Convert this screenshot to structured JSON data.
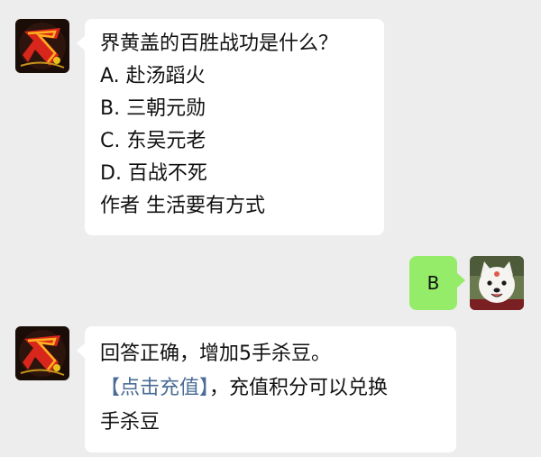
{
  "messages": [
    {
      "sender": "official",
      "avatar_icon": "sanguosha-sha-logo-icon",
      "lines": [
        "界黄盖的百胜战功是什么？",
        "A. 赴汤蹈火",
        "B. 三朝元勋",
        "C. 东吴元老",
        "D. 百战不死",
        "作者 生活要有方式"
      ]
    },
    {
      "sender": "user",
      "avatar_icon": "samoyed-dog-avatar-icon",
      "text": "B"
    },
    {
      "sender": "official",
      "avatar_icon": "sanguosha-sha-logo-icon",
      "line1": "回答正确，增加5手杀豆。",
      "link_text": "【点击充值】",
      "line2_rest": "，充值积分可以兑换",
      "line3": "手杀豆"
    }
  ],
  "colors": {
    "background": "#ededed",
    "bubble_left": "#ffffff",
    "bubble_right": "#95ec69",
    "link": "#4a6c96"
  }
}
